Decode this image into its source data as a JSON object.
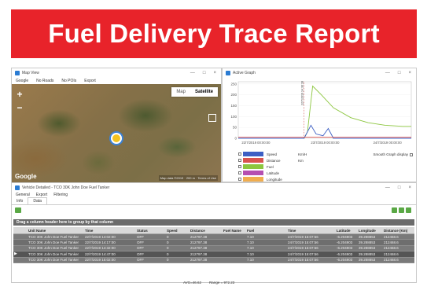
{
  "banner": {
    "title": "Fuel Delivery Trace Report"
  },
  "map_window": {
    "title": "Map View",
    "menu": [
      "Google",
      "No Roads",
      "No POIs",
      "Export"
    ],
    "map_type": {
      "map": "Map",
      "satellite": "Satellite"
    },
    "zoom_in": "+",
    "zoom_out": "−",
    "google": "Google",
    "footer": "Map data ©2019 · 200 m · Terms of Use"
  },
  "graph_window": {
    "title": "Active Graph",
    "smooth_label": "Smooth Graph display",
    "legend": [
      {
        "name": "Speed",
        "unit": "Km/H",
        "color": "#3d5fc4"
      },
      {
        "name": "Distance",
        "unit": "Km",
        "color": "#d9534f"
      },
      {
        "name": "Fuel",
        "unit": "",
        "color": "#8cc63f"
      },
      {
        "name": "Latitude",
        "unit": "",
        "color": "#b54fb0"
      },
      {
        "name": "Longitude",
        "unit": "",
        "color": "#f0ad4e"
      }
    ]
  },
  "chart_data": {
    "type": "line",
    "yticks": [
      0,
      50,
      100,
      150,
      200,
      250
    ],
    "ylim": [
      0,
      260
    ],
    "x_tick_labels": [
      "22/7/2019 00:00:00",
      "23/7/2019 00:00:00",
      "24/7/2019 00:00:00"
    ],
    "marker_label": "22/7/2019 14:36:16",
    "series": [
      {
        "name": "Fuel",
        "color": "#8cc63f",
        "points": [
          [
            0.0,
            0
          ],
          [
            0.38,
            0
          ],
          [
            0.4,
            30
          ],
          [
            0.43,
            240
          ],
          [
            0.48,
            200
          ],
          [
            0.55,
            140
          ],
          [
            0.65,
            95
          ],
          [
            0.75,
            72
          ],
          [
            0.85,
            60
          ],
          [
            0.95,
            55
          ],
          [
            1.0,
            55
          ]
        ]
      },
      {
        "name": "Speed",
        "color": "#3d5fc4",
        "points": [
          [
            0.0,
            0
          ],
          [
            0.38,
            0
          ],
          [
            0.42,
            60
          ],
          [
            0.45,
            20
          ],
          [
            0.49,
            12
          ],
          [
            0.52,
            45
          ],
          [
            0.55,
            0
          ],
          [
            1.0,
            0
          ]
        ]
      },
      {
        "name": "Distance",
        "color": "#d9534f",
        "points": [
          [
            0.0,
            5
          ],
          [
            1.0,
            5
          ]
        ]
      }
    ]
  },
  "detail_window": {
    "title": "Vehicle Detailed - TCO 30K John Doe Fuel Tanker",
    "menu": [
      "General",
      "Export",
      "Filtering"
    ],
    "tabs": [
      "Info",
      "Data"
    ],
    "group_hint": "Drag a column header here to group by that column",
    "columns": [
      "",
      "Unit Name",
      "Time",
      "Status",
      "Speed",
      "Distance",
      "Fuel Name",
      "Fuel",
      "Time",
      "Latitude",
      "Longitude",
      "Distance (Km)"
    ],
    "rows": [
      [
        "",
        "TCO 30K John Doe Fuel Tanker",
        "22/7/2019 14:02:00",
        "OFF",
        "0",
        "212797.38",
        "",
        "7.10",
        "24/7/2019 15:07:56",
        "-6.204903",
        "39.288853",
        "212468.6"
      ],
      [
        "",
        "TCO 30K John Doe Fuel Tanker",
        "22/7/2019 14:17:00",
        "OFF",
        "0",
        "212797.38",
        "",
        "7.10",
        "24/7/2019 15:07:56",
        "-6.204903",
        "39.288853",
        "212468.6"
      ],
      [
        "",
        "TCO 30K John Doe Fuel Tanker",
        "22/7/2019 14:32:00",
        "OFF",
        "0",
        "212797.38",
        "",
        "7.10",
        "24/7/2019 15:07:56",
        "-6.204903",
        "39.288853",
        "212468.6"
      ],
      [
        "▶",
        "TCO 30K John Doe Fuel Tanker",
        "22/7/2019 14:47:00",
        "OFF",
        "0",
        "212797.38",
        "",
        "7.10",
        "24/7/2019 15:07:56",
        "-6.204903",
        "39.288853",
        "212468.6"
      ],
      [
        "",
        "TCO 30K John Doe Fuel Tanker",
        "22/7/2019 15:02:00",
        "OFF",
        "0",
        "212797.38",
        "",
        "7.10",
        "24/7/2019 15:07:56",
        "-6.204903",
        "39.288853",
        "212468.6"
      ]
    ],
    "totals": {
      "avg": "AVG=46.62",
      "range": "Range = 972.23"
    }
  }
}
